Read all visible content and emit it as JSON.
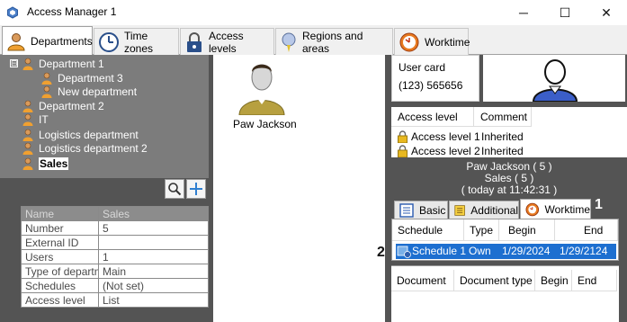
{
  "window": {
    "title": "Access Manager 1",
    "controls": {
      "minimize": "─",
      "maximize": "☐",
      "close": "✕"
    }
  },
  "tabs": [
    {
      "label": "Departments",
      "icon": "person-icon",
      "active": true
    },
    {
      "label": "Time zones",
      "icon": "clock-icon",
      "active": false
    },
    {
      "label": "Access levels",
      "icon": "padlock-icon",
      "active": false
    },
    {
      "label": "Regions and areas",
      "icon": "pin-icon",
      "active": false
    },
    {
      "label": "Worktime",
      "icon": "worktime-clock-icon",
      "active": false
    }
  ],
  "tree": {
    "expander": "⊟",
    "items": [
      {
        "label": "Department 1",
        "level": 0
      },
      {
        "label": "Department 3",
        "level": 1
      },
      {
        "label": "New department",
        "level": 1
      },
      {
        "label": "Department 2",
        "level": 0
      },
      {
        "label": "IT",
        "level": 0
      },
      {
        "label": "Logistics department",
        "level": 0
      },
      {
        "label": "Logistics department 2",
        "level": 0
      },
      {
        "label": "Sales",
        "level": 0,
        "selected": true
      }
    ]
  },
  "toolbar": {
    "search_icon": "search-icon",
    "add_icon": "plus-icon"
  },
  "properties": [
    {
      "key": "Name",
      "value": "Sales"
    },
    {
      "key": "Number",
      "value": "5"
    },
    {
      "key": "External ID",
      "value": ""
    },
    {
      "key": "Users",
      "value": "1"
    },
    {
      "key": "Type of department",
      "value": "Main"
    },
    {
      "key": "Schedules",
      "value": "(Not set)"
    },
    {
      "key": "Access level",
      "value": "List"
    }
  ],
  "employee": {
    "name": "Paw Jackson"
  },
  "user_card": {
    "title": "User card",
    "number": "(123) 565656"
  },
  "access_table": {
    "headers": [
      "Access level",
      "Comment"
    ],
    "rows": [
      {
        "level": "Access level 1",
        "comment": "Inherited"
      },
      {
        "level": "Access level 2",
        "comment": "Inherited"
      }
    ]
  },
  "summary": {
    "line1": "Paw Jackson ( 5 )",
    "line2": "Sales ( 5 )",
    "line3": "( today at 11:42:31 )"
  },
  "right_tabs": [
    {
      "label": "Basic",
      "icon": "list-icon"
    },
    {
      "label": "Additional",
      "icon": "notes-icon"
    },
    {
      "label": "Worktime",
      "icon": "worktime-clock-icon",
      "active": true
    }
  ],
  "markers": {
    "m1": "1",
    "m2": "2"
  },
  "schedule_table": {
    "headers": [
      "Schedule",
      "Type",
      "Begin",
      "End"
    ],
    "row": {
      "schedule": "Schedule 1",
      "type": "Own",
      "begin": "1/29/2024",
      "end": "1/29/2124"
    }
  },
  "documents_table": {
    "headers": [
      "Document",
      "Document type",
      "Begin",
      "End"
    ]
  },
  "colors": {
    "selection": "#1d6fd0",
    "pane_dark": "#545454",
    "tree_bg": "#7c7c7c"
  }
}
